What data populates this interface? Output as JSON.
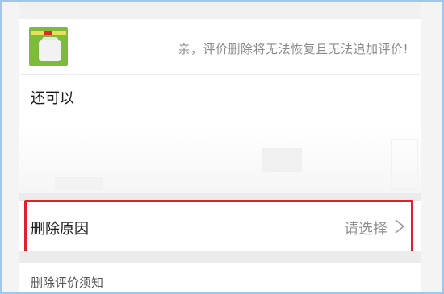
{
  "product": {
    "thumbnail": "product-bag-image",
    "notice": "亲，评价删除将无法恢复且无法追加评价!"
  },
  "review": {
    "text": "还可以"
  },
  "reason": {
    "label": "删除原因",
    "value": "请选择",
    "icon": "chevron-right-icon"
  },
  "footer": {
    "label": "删除评价须知"
  },
  "colors": {
    "highlight": "#e0212c",
    "frame": "#9ec7ea",
    "thumbnail_bg": "#7dbb3a"
  }
}
